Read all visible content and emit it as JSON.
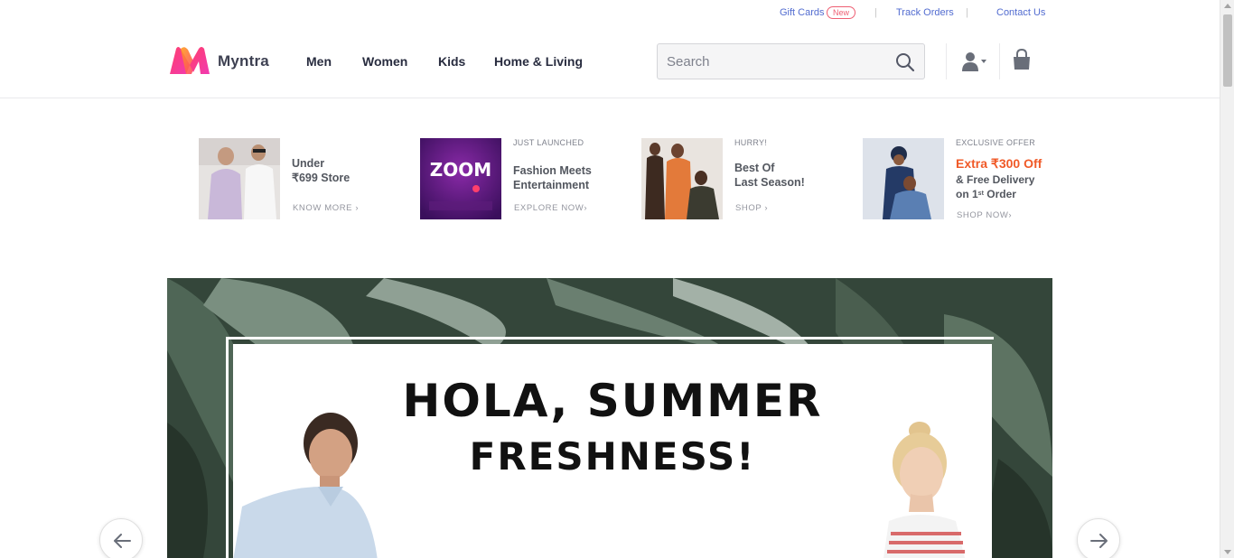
{
  "utility": {
    "gift_cards": "Gift Cards",
    "new_badge": "New",
    "track_orders": "Track Orders",
    "contact_us": "Contact Us",
    "separator": "|"
  },
  "header": {
    "brand": "Myntra",
    "nav": [
      "Men",
      "Women",
      "Kids",
      "Home & Living"
    ],
    "search_placeholder": "Search"
  },
  "promos": [
    {
      "kicker": "",
      "title_lines": [
        "Under",
        "₹699 Store"
      ],
      "cta": "KNOW MORE ›"
    },
    {
      "kicker": "JUST LAUNCHED",
      "title_lines": [
        "Fashion Meets",
        "Entertainment"
      ],
      "cta": "EXPLORE NOW›",
      "thumb_text": "ZOOM"
    },
    {
      "kicker": "HURRY!",
      "title_lines": [
        "Best Of",
        "Last Season!"
      ],
      "cta": "SHOP ›"
    },
    {
      "kicker": "EXCLUSIVE OFFER",
      "accent": "Extra ₹300 Off",
      "title_lines": [
        "& Free Delivery",
        "on 1"
      ],
      "title_sup": "st",
      "title_tail": " Order",
      "cta": "SHOP NOW›"
    }
  ],
  "hero": {
    "line1": "HOLA, SUMMER",
    "line2": "FRESHNESS!"
  },
  "colors": {
    "link": "#526cd0",
    "accent_orange": "#f05a28",
    "badge_pink": "#ee5f73",
    "hero_leaf": "#2f3e32"
  },
  "icons": [
    "myntra-logo",
    "search-icon",
    "user-icon",
    "bag-icon",
    "arrow-left-icon",
    "arrow-right-icon"
  ]
}
